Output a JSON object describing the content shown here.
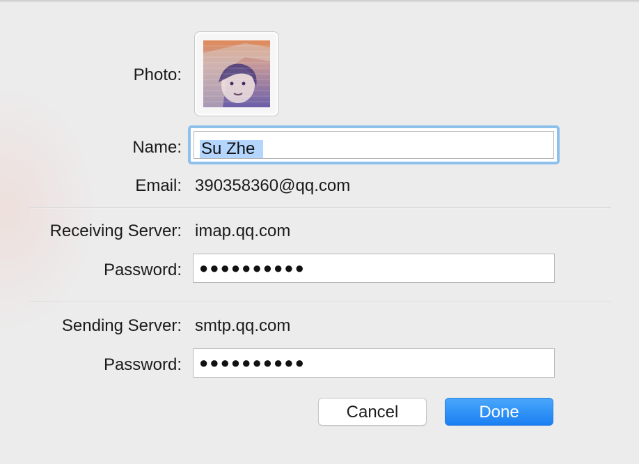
{
  "photo": {
    "label": "Photo:"
  },
  "name": {
    "label": "Name:",
    "value": "Su Zhe"
  },
  "email": {
    "label": "Email:",
    "value": "390358360@qq.com"
  },
  "receiving": {
    "label": "Receiving Server:",
    "server": "imap.qq.com",
    "password_label": "Password:",
    "password_mask": "●●●●●●●●●●"
  },
  "sending": {
    "label": "Sending Server:",
    "server": "smtp.qq.com",
    "password_label": "Password:",
    "password_mask": "●●●●●●●●●●"
  },
  "buttons": {
    "cancel": "Cancel",
    "done": "Done"
  },
  "colors": {
    "accent": "#1a7ff2",
    "focus_ring": "#8ec0ec",
    "selection": "#b4d5fe"
  }
}
